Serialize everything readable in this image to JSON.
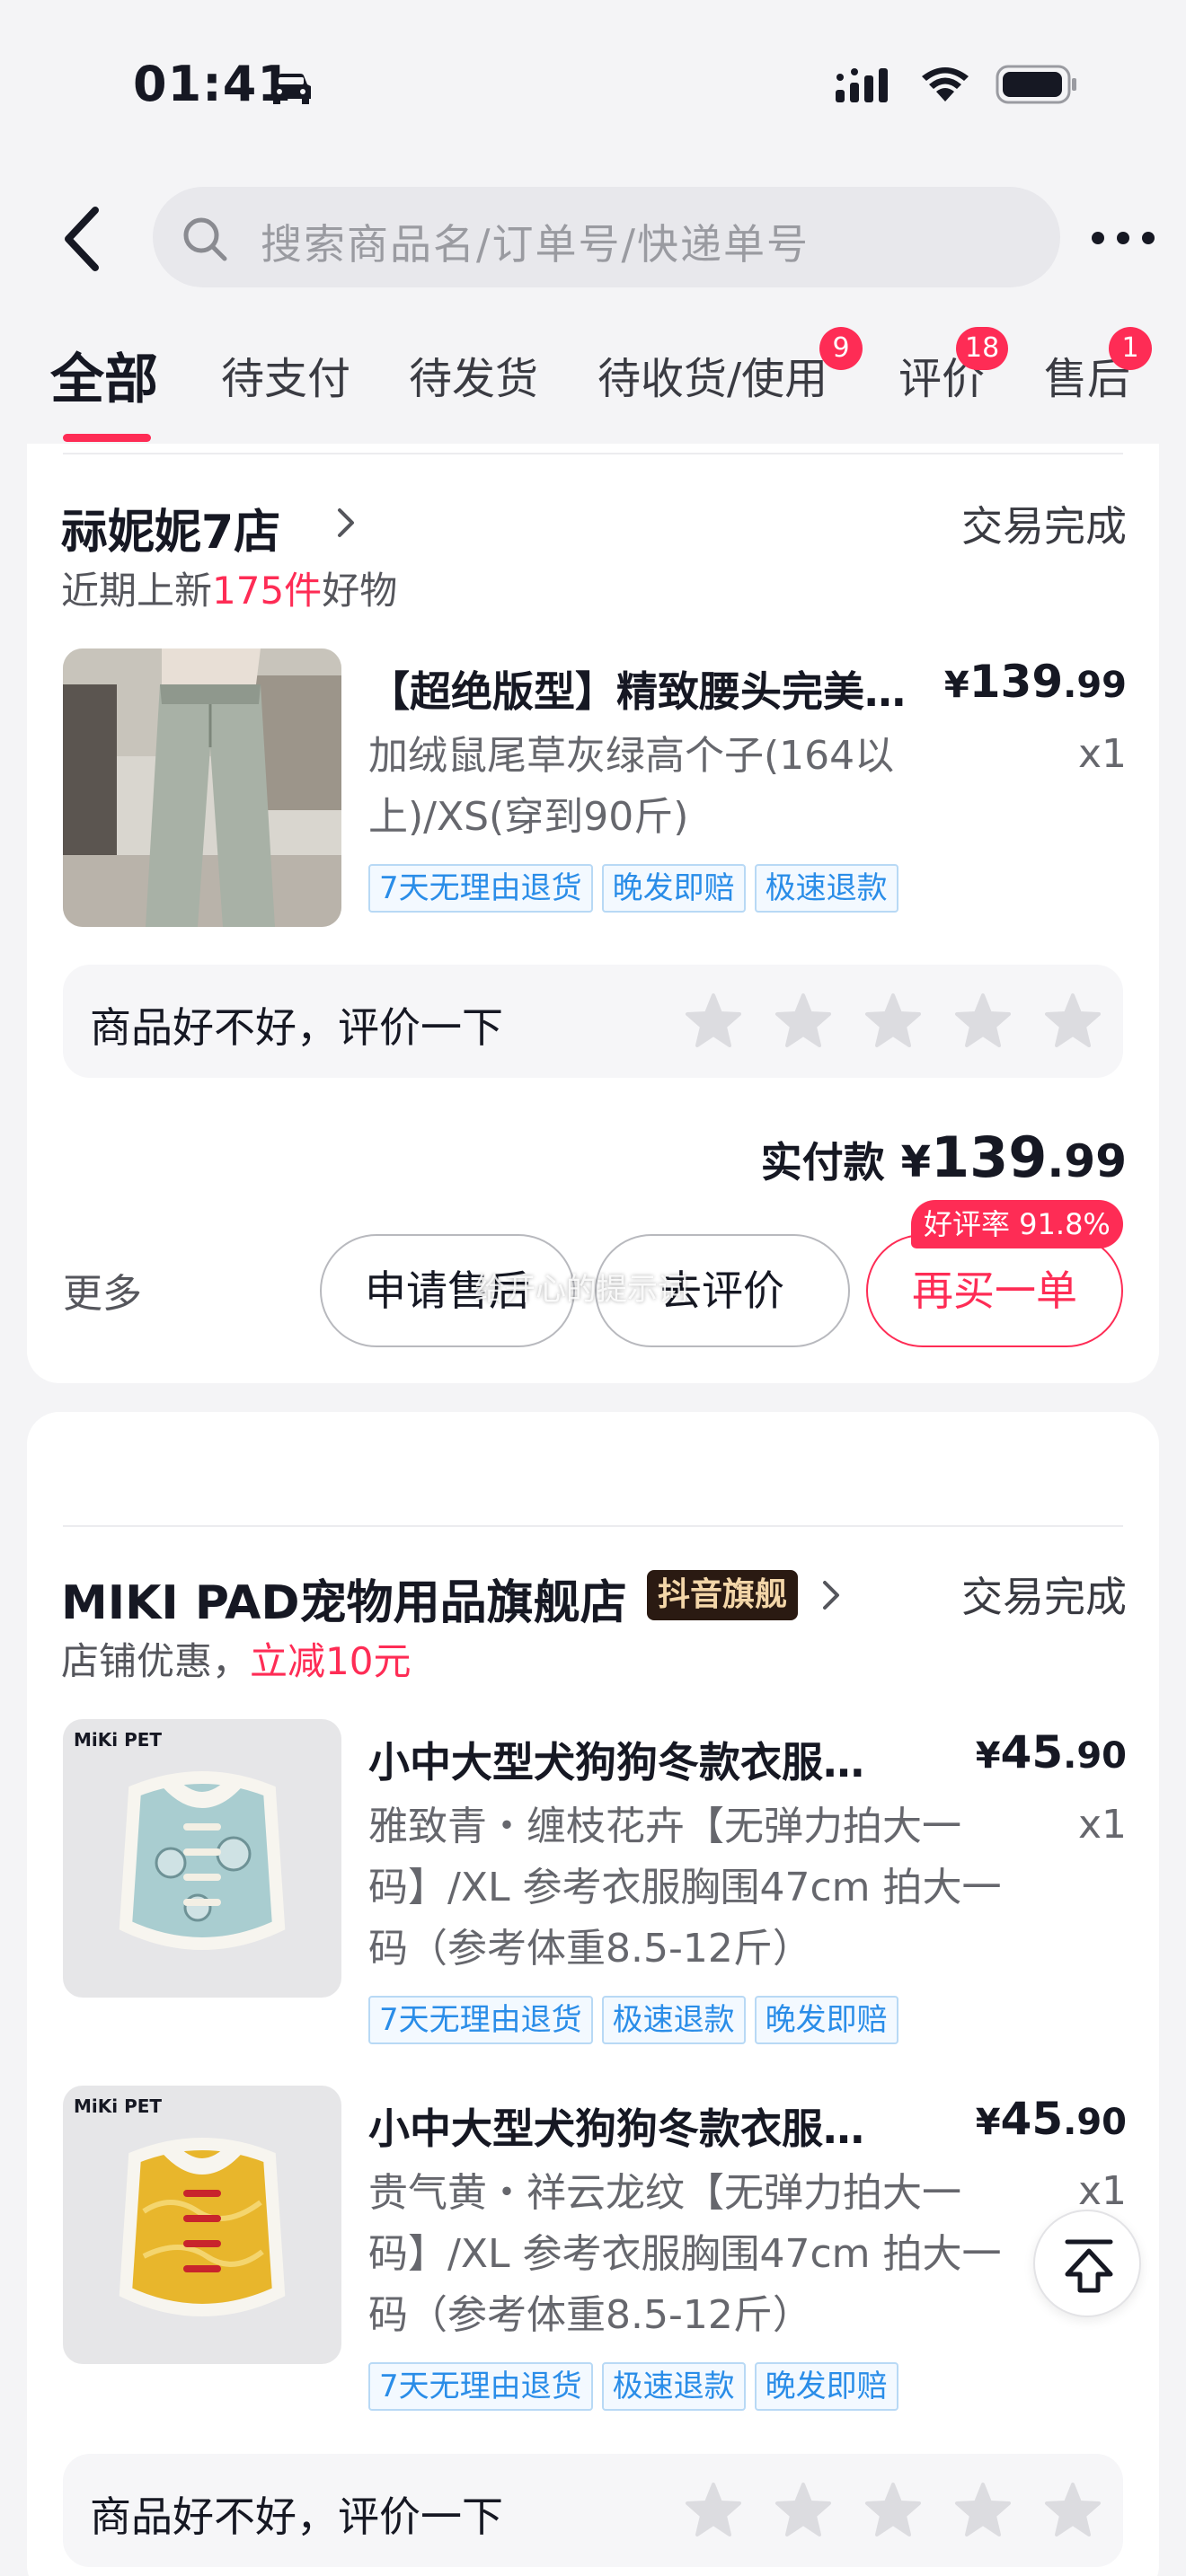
{
  "status_bar": {
    "time": "01:41"
  },
  "search": {
    "placeholder": "搜索商品名/订单号/快递单号"
  },
  "tabs": [
    {
      "label": "全部",
      "active": true
    },
    {
      "label": "待支付"
    },
    {
      "label": "待发货"
    },
    {
      "label": "待收货/使用",
      "badge": "9"
    },
    {
      "label": "评价",
      "badge": "18"
    },
    {
      "label": "售后",
      "badge": "1"
    }
  ],
  "orders": [
    {
      "shop_name": "祘妮妮7店",
      "status": "交易完成",
      "shop_sub_prefix": "近期上新",
      "shop_sub_highlight": "175件",
      "shop_sub_suffix": "好物",
      "items": [
        {
          "image": "jeans-photo",
          "title": "【超绝版型】精致腰头完美…",
          "price_currency": "¥",
          "price_int": "139",
          "price_dec": ".99",
          "spec": "加绒鼠尾草灰绿高个子(164以上)/XS(穿到90斤)",
          "qty": "x1",
          "tags": [
            "7天无理由退货",
            "晚发即赔",
            "极速退款"
          ]
        }
      ],
      "review_prompt": "商品好不好，评价一下",
      "paid_label": "实付款",
      "paid_currency": "¥",
      "paid_int": "139",
      "paid_dec": ".99",
      "more_label": "更多",
      "buttons": [
        "申请售后",
        "去评价",
        "再买一单"
      ],
      "rate_badge": "好评率 91.8%",
      "toast": "给开心的提示词"
    },
    {
      "shop_name": "MIKI PAD宠物用品旗舰店",
      "flagship_badge": "抖音旗舰",
      "status": "交易完成",
      "shop_sub_prefix": "店铺优惠，",
      "shop_sub_highlight": "立减10元",
      "items": [
        {
          "image": "blue-dog-vest",
          "brand_mark": "MiKi PET",
          "title": "小中大型犬狗狗冬款衣服…",
          "price_currency": "¥",
          "price_int": "45",
          "price_dec": ".90",
          "spec": "雅致青・缠枝花卉【无弹力拍大一码】/XL 参考衣服胸围47cm 拍大一码（参考体重8.5-12斤）",
          "qty": "x1",
          "tags": [
            "7天无理由退货",
            "极速退款",
            "晚发即赔"
          ]
        },
        {
          "image": "yellow-dog-vest",
          "brand_mark": "MiKi PET",
          "title": "小中大型犬狗狗冬款衣服…",
          "price_currency": "¥",
          "price_int": "45",
          "price_dec": ".90",
          "spec": "贵气黄・祥云龙纹【无弹力拍大一码】/XL 参考衣服胸围47cm 拍大一码（参考体重8.5-12斤）",
          "qty": "x1",
          "tags": [
            "7天无理由退货",
            "极速退款",
            "晚发即赔"
          ]
        }
      ],
      "review_prompt": "商品好不好，评价一下"
    }
  ],
  "colors": {
    "accent": "#fe2c55",
    "tag_blue": "#2a8de8",
    "background": "#f4f4f6"
  }
}
